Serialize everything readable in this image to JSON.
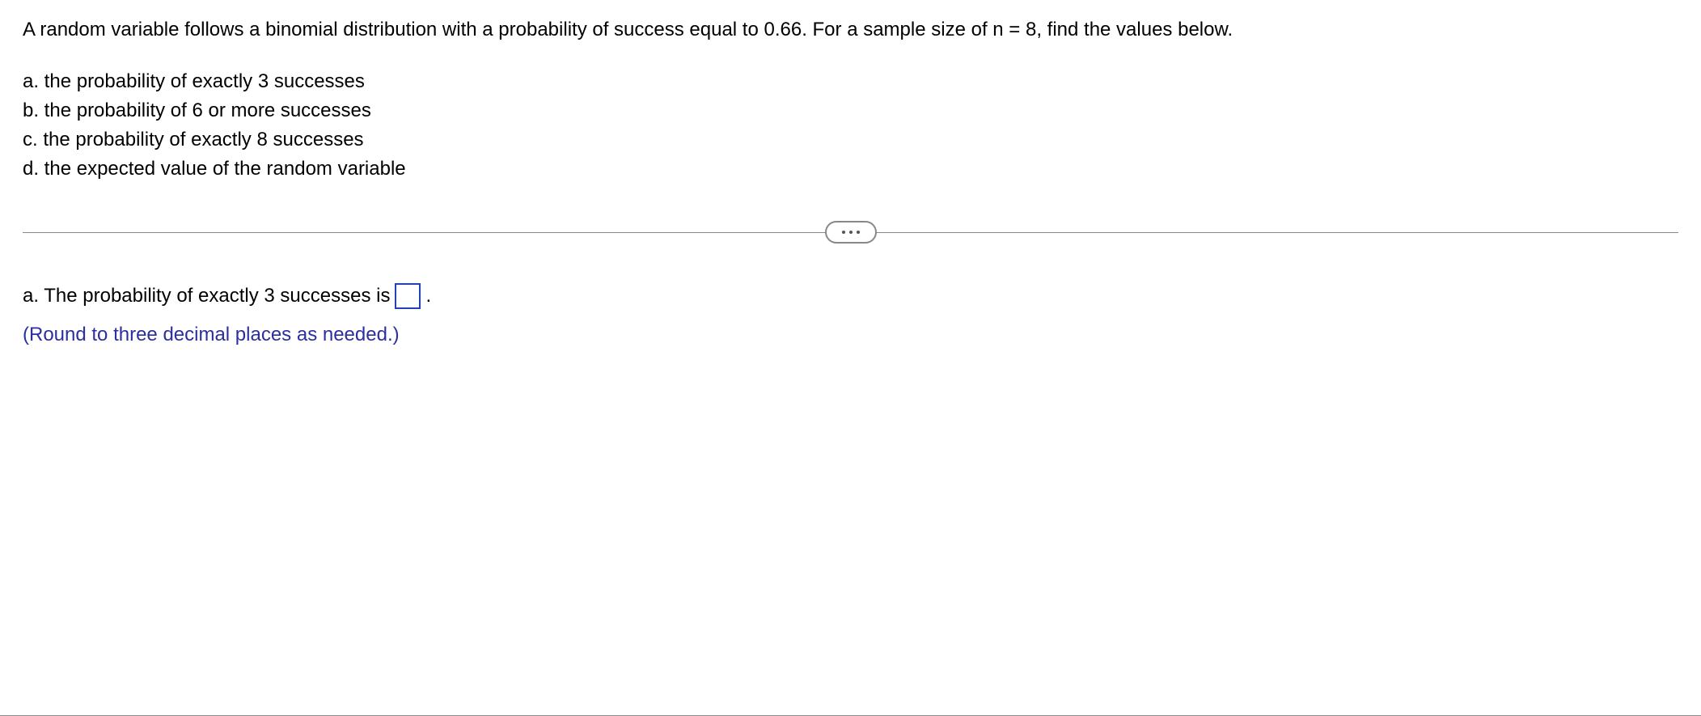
{
  "question": {
    "intro": "A random variable follows a binomial distribution with a probability of success equal to 0.66. For a sample size of n = 8, find the values below.",
    "parts": {
      "a": "a. the probability of exactly 3 successes",
      "b": "b. the probability of 6 or more successes",
      "c": "c. the probability of exactly 8 successes",
      "d": "d. the expected value of the random variable"
    }
  },
  "answer": {
    "prefix": "a. The probability of exactly 3 successes is",
    "suffix": ".",
    "input_value": "",
    "hint": "(Round to three decimal places as needed.)"
  }
}
